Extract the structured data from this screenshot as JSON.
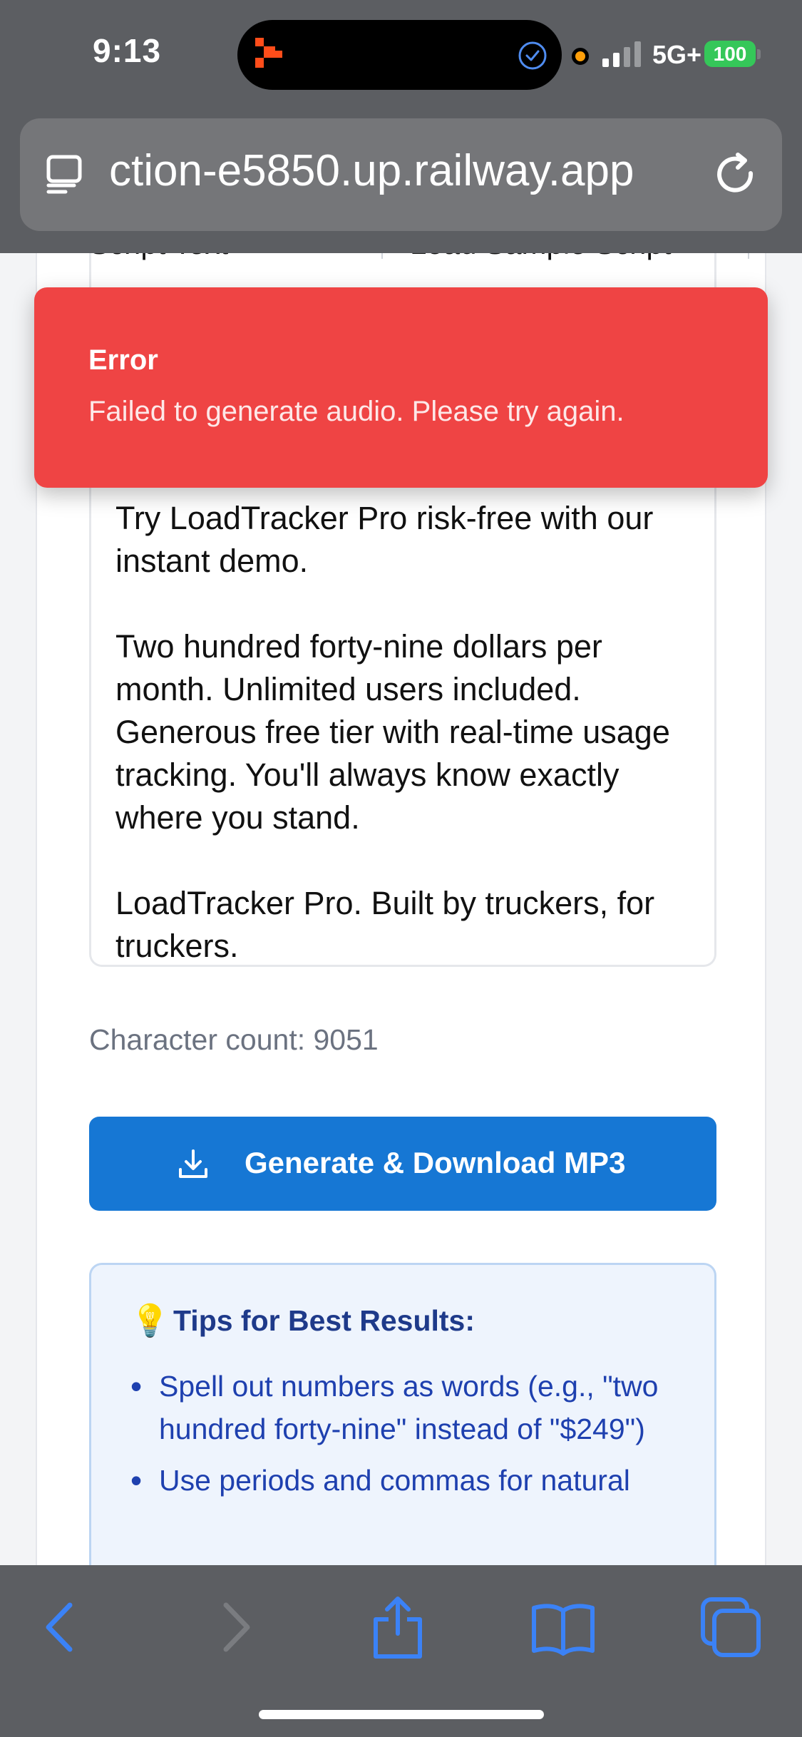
{
  "status_bar": {
    "time": "9:13",
    "network": "5G+",
    "battery": "100"
  },
  "browser": {
    "url": "ction-e5850.up.railway.app",
    "icons": [
      "reader-icon",
      "reload-icon",
      "back-icon",
      "forward-icon",
      "share-icon",
      "bookmarks-icon",
      "tabs-icon"
    ]
  },
  "page": {
    "tab_left": "Script Text",
    "tab_right": "Load Sample Script",
    "script_text": "Try LoadTracker Pro risk-free with our instant demo.\n\nTwo hundred forty-nine dollars per month. Unlimited users included. Generous free tier with real-time usage tracking. You'll always know exactly where you stand.\n\nLoadTracker Pro. Built by truckers, for truckers.",
    "char_count": "Character count: 9051",
    "generate_button": "Generate & Download MP3",
    "tips": {
      "title": "Tips for Best Results:",
      "items": [
        "Spell out numbers as words (e.g., \"two hundred forty-nine\" instead of \"$249\")",
        "Use periods and commas for natural"
      ]
    }
  },
  "toast": {
    "title": "Error",
    "message": "Failed to generate audio. Please try again."
  },
  "colors": {
    "primary": "#1677d4",
    "error": "#ef4444",
    "chrome": "#5c5e62",
    "toolbar_icon": "#3b82f6",
    "battery": "#35c759"
  }
}
